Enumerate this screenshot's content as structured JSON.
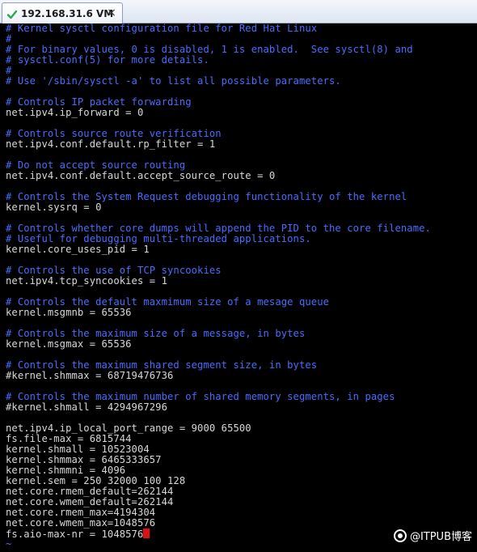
{
  "tab": {
    "title": "192.168.31.6 VM",
    "close_glyph": "×"
  },
  "terminal": {
    "lines": [
      {
        "kind": "comment",
        "text": "# Kernel sysctl configuration file for Red Hat Linux"
      },
      {
        "kind": "comment",
        "text": "#"
      },
      {
        "kind": "comment",
        "text": "# For binary values, 0 is disabled, 1 is enabled.  See sysctl(8) and"
      },
      {
        "kind": "comment",
        "text": "# sysctl.conf(5) for more details."
      },
      {
        "kind": "comment",
        "text": "#"
      },
      {
        "kind": "comment",
        "text": "# Use '/sbin/sysctl -a' to list all possible parameters."
      },
      {
        "kind": "blank",
        "text": ""
      },
      {
        "kind": "comment",
        "text": "# Controls IP packet forwarding"
      },
      {
        "kind": "text",
        "text": "net.ipv4.ip_forward = 0"
      },
      {
        "kind": "blank",
        "text": ""
      },
      {
        "kind": "comment",
        "text": "# Controls source route verification"
      },
      {
        "kind": "text",
        "text": "net.ipv4.conf.default.rp_filter = 1"
      },
      {
        "kind": "blank",
        "text": ""
      },
      {
        "kind": "comment",
        "text": "# Do not accept source routing"
      },
      {
        "kind": "text",
        "text": "net.ipv4.conf.default.accept_source_route = 0"
      },
      {
        "kind": "blank",
        "text": ""
      },
      {
        "kind": "comment",
        "text": "# Controls the System Request debugging functionality of the kernel"
      },
      {
        "kind": "text",
        "text": "kernel.sysrq = 0"
      },
      {
        "kind": "blank",
        "text": ""
      },
      {
        "kind": "comment",
        "text": "# Controls whether core dumps will append the PID to the core filename."
      },
      {
        "kind": "comment",
        "text": "# Useful for debugging multi-threaded applications."
      },
      {
        "kind": "text",
        "text": "kernel.core_uses_pid = 1"
      },
      {
        "kind": "blank",
        "text": ""
      },
      {
        "kind": "comment",
        "text": "# Controls the use of TCP syncookies"
      },
      {
        "kind": "text",
        "text": "net.ipv4.tcp_syncookies = 1"
      },
      {
        "kind": "blank",
        "text": ""
      },
      {
        "kind": "comment",
        "text": "# Controls the default maxmimum size of a mesage queue"
      },
      {
        "kind": "text",
        "text": "kernel.msgmnb = 65536"
      },
      {
        "kind": "blank",
        "text": ""
      },
      {
        "kind": "comment",
        "text": "# Controls the maximum size of a message, in bytes"
      },
      {
        "kind": "text",
        "text": "kernel.msgmax = 65536"
      },
      {
        "kind": "blank",
        "text": ""
      },
      {
        "kind": "comment",
        "text": "# Controls the maximum shared segment size, in bytes"
      },
      {
        "kind": "text",
        "text": "#kernel.shmmax = 68719476736"
      },
      {
        "kind": "blank",
        "text": ""
      },
      {
        "kind": "comment",
        "text": "# Controls the maximum number of shared memory segments, in pages"
      },
      {
        "kind": "text",
        "text": "#kernel.shmall = 4294967296"
      },
      {
        "kind": "blank",
        "text": ""
      },
      {
        "kind": "text",
        "text": "net.ipv4.ip_local_port_range = 9000 65500"
      },
      {
        "kind": "text",
        "text": "fs.file-max = 6815744"
      },
      {
        "kind": "text",
        "text": "kernel.shmall = 10523004"
      },
      {
        "kind": "text",
        "text": "kernel.shmmax = 6465333657"
      },
      {
        "kind": "text",
        "text": "kernel.shmmni = 4096"
      },
      {
        "kind": "text",
        "text": "kernel.sem = 250 32000 100 128"
      },
      {
        "kind": "text",
        "text": "net.core.rmem_default=262144"
      },
      {
        "kind": "text",
        "text": "net.core.wmem_default=262144"
      },
      {
        "kind": "text",
        "text": "net.core.rmem_max=4194304"
      },
      {
        "kind": "text",
        "text": "net.core.wmem_max=1048576"
      },
      {
        "kind": "text",
        "text": "fs.aio-max-nr = 1048576",
        "cursor": true
      },
      {
        "kind": "tilde",
        "text": "~"
      }
    ]
  },
  "watermark": {
    "text": "@ITPUB博客"
  },
  "colors": {
    "terminal_bg": "#000000",
    "comment": "#4a6cff",
    "text": "#d8d8d8",
    "cursor": "#e01010",
    "tab_check": "#2fa84f"
  }
}
